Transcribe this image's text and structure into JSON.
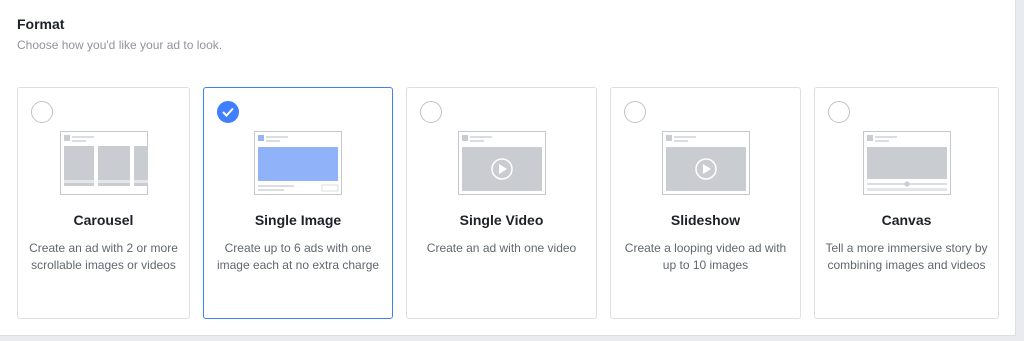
{
  "header": {
    "title": "Format",
    "subtitle": "Choose how you'd like your ad to look."
  },
  "formats": [
    {
      "id": "carousel",
      "title": "Carousel",
      "description": "Create an ad with 2 or more scrollable images or videos",
      "selected": false,
      "icon": "carousel-preview-icon"
    },
    {
      "id": "single-image",
      "title": "Single Image",
      "description": "Create up to 6 ads with one image each at no extra charge",
      "selected": true,
      "icon": "single-image-preview-icon"
    },
    {
      "id": "single-video",
      "title": "Single Video",
      "description": "Create an ad with one video",
      "selected": false,
      "icon": "single-video-preview-icon"
    },
    {
      "id": "slideshow",
      "title": "Slideshow",
      "description": "Create a looping video ad with up to 10 images",
      "selected": false,
      "icon": "slideshow-preview-icon"
    },
    {
      "id": "canvas",
      "title": "Canvas",
      "description": "Tell a more immersive story by combining images and videos",
      "selected": false,
      "icon": "canvas-preview-icon"
    }
  ],
  "colors": {
    "accent": "#4080ff",
    "border": "#dddfe2",
    "muted_text": "#90949c",
    "placeholder_gray": "#bec2c9",
    "selected_fill": "#8fb2f8"
  }
}
